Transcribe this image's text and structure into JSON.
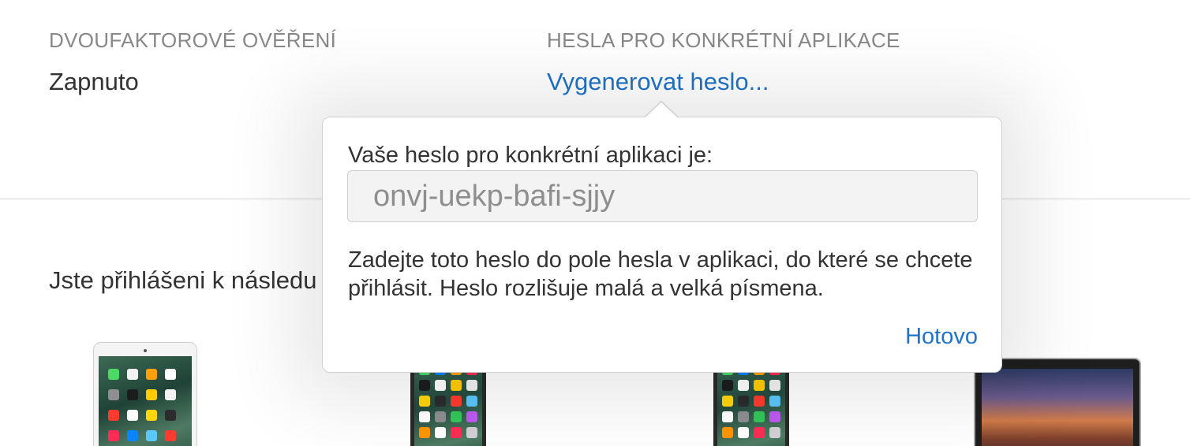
{
  "two_factor": {
    "label": "DVOUFAKTOROVÉ OVĚŘENÍ",
    "value": "Zapnuto"
  },
  "app_specific_passwords": {
    "label": "HESLA PRO KONKRÉTNÍ APLIKACE",
    "link": "Vygenerovat heslo..."
  },
  "devices_section": {
    "text": "Jste přihlášeni k následu"
  },
  "devices": [
    {
      "kind": "ipad-icon"
    },
    {
      "kind": "iphone-icon"
    },
    {
      "kind": "iphone-icon"
    },
    {
      "kind": "macbook-icon"
    }
  ],
  "popover": {
    "heading": "Vaše heslo pro konkrétní aplikaci je:",
    "password": "onvj-uekp-bafi-sjjy",
    "description": "Zadejte toto heslo do pole hesla v aplikaci, do které se chcete přihlásit. Heslo rozlišuje malá a velká písmena.",
    "done": "Hotovo"
  },
  "colors": {
    "link": "#1f73c8",
    "label": "#888888",
    "text": "#333333"
  }
}
